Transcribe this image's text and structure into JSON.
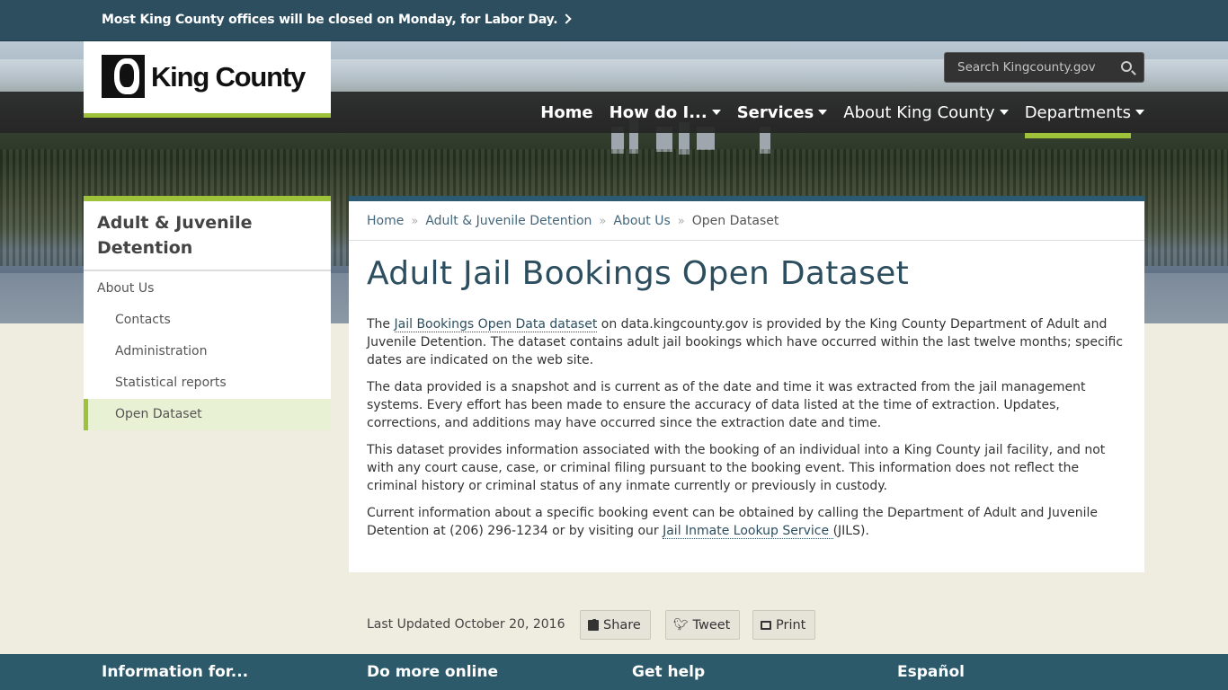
{
  "alert": {
    "text": "Most King County offices will be closed on Monday, for Labor Day."
  },
  "logo": {
    "text": "King County"
  },
  "search": {
    "placeholder": "Search Kingcounty.gov"
  },
  "nav": {
    "home": "Home",
    "how_do_i": "How do I...",
    "services": "Services",
    "about": "About King County",
    "departments": "Departments"
  },
  "sidebar": {
    "title": "Adult & Juvenile Detention",
    "items": [
      {
        "label": "About Us"
      },
      {
        "label": "Contacts"
      },
      {
        "label": "Administration"
      },
      {
        "label": "Statistical reports"
      },
      {
        "label": "Open Dataset"
      }
    ]
  },
  "breadcrumb": [
    "Home",
    "Adult & Juvenile Detention",
    "About Us",
    "Open Dataset"
  ],
  "page": {
    "title": "Adult Jail Bookings Open Dataset",
    "p1_a": "The ",
    "p1_link": "Jail Bookings Open Data dataset",
    "p1_b": " on data.kingcounty.gov is provided by the King County Department of Adult and Juvenile Detention. The dataset contains adult jail bookings which have occurred within the last twelve months; specific dates are indicated on the web site.",
    "p2": "The data provided is a snapshot and is current as of the date and time it was extracted from the jail management systems. Every effort has been made to ensure the accuracy of data listed at the time of extraction. Updates, corrections, and additions may have occurred since the extraction date and time.",
    "p3": "This dataset provides information associated with the booking of an individual into a King County jail facility, and not with any court cause, case, or criminal filing pursuant to the booking event. This information does not reflect the criminal history or criminal status of any inmate currently or previously in custody.",
    "p4_a": "Current information about a specific booking event can be obtained by calling the Department of Adult and Juvenile Detention at (206) 296-1234 or by visiting our ",
    "p4_link": "Jail Inmate Lookup Service ",
    "p4_b": "(JILS)."
  },
  "updated": "Last Updated October 20, 2016",
  "share": {
    "share": "Share",
    "tweet": "Tweet",
    "print": "Print"
  },
  "footer": {
    "info": "Information for...",
    "online": "Do more online",
    "help": "Get help",
    "espanol": "Español"
  },
  "colors": {
    "accent": "#9ec33b",
    "header": "#2c4e5f",
    "title": "#2c4e5f"
  }
}
